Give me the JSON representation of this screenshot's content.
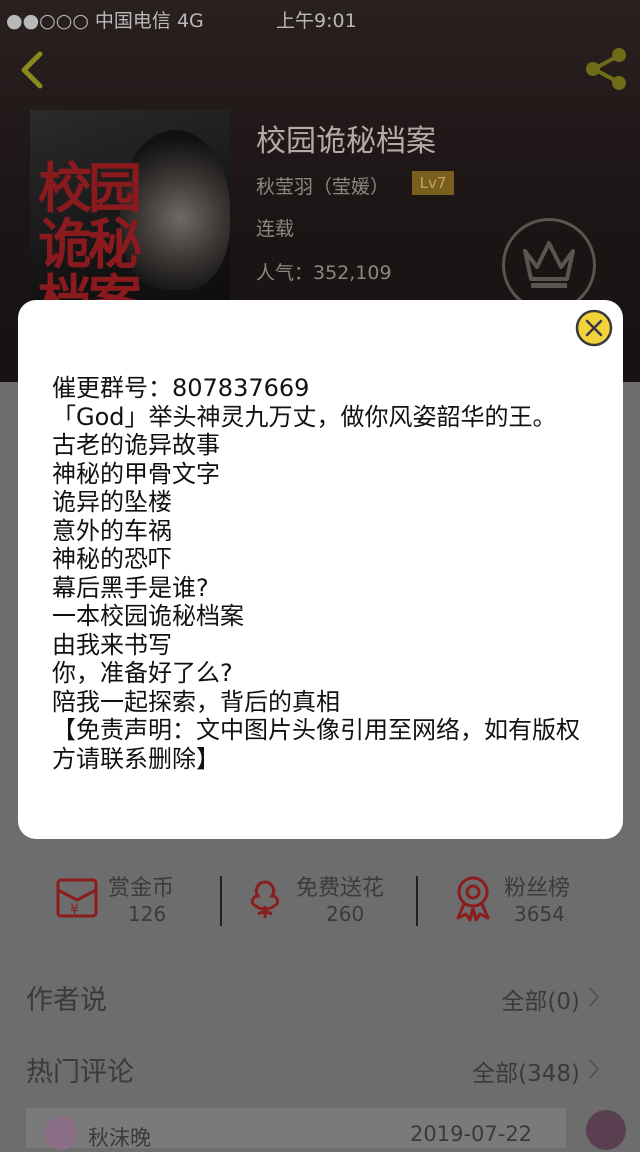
{
  "status_bar": {
    "carrier": "●●○○○ 中国电信   4G",
    "time": "上午9:01"
  },
  "header": {
    "back_icon": "chevron-left-icon",
    "share_icon": "share-icon",
    "accent_color": "#8c8a1c"
  },
  "book": {
    "cover_title": "校园诡秘档案",
    "title": "校园诡秘档案",
    "author": "秋莹羽（莹媛）",
    "level": "Lv7",
    "status": "连载",
    "popularity": "人气：352,109",
    "crown_icon": "crown-icon"
  },
  "dialog": {
    "close_icon": "close-icon",
    "close_color": "#f2d33b",
    "text": "催更群号：807837669\n「God」举头神灵九万丈，做你风姿韶华的王。\n古老的诡异故事\n神秘的甲骨文字\n诡异的坠楼\n意外的车祸\n神秘的恐吓\n幕后黑手是谁?\n一本校园诡秘档案\n由我来书写\n你，准备好了么?\n陪我一起探索，背后的真相\n【免责声明：文中图片头像引用至网络，如有版权方请联系删除】"
  },
  "stats": [
    {
      "label": "赏金币",
      "value": "126",
      "icon": "red-envelope-icon"
    },
    {
      "label": "免费送花",
      "value": "260",
      "icon": "flower-icon"
    },
    {
      "label": "粉丝榜",
      "value": "3654",
      "icon": "ribbon-badge-icon"
    }
  ],
  "sections": {
    "author_says": {
      "title": "作者说",
      "link": "全部(0)"
    },
    "hot_comments": {
      "title": "热门评论",
      "link": "全部(348)"
    }
  },
  "comment_preview": {
    "name": "秋沫晚",
    "date": "2019-07-22"
  }
}
